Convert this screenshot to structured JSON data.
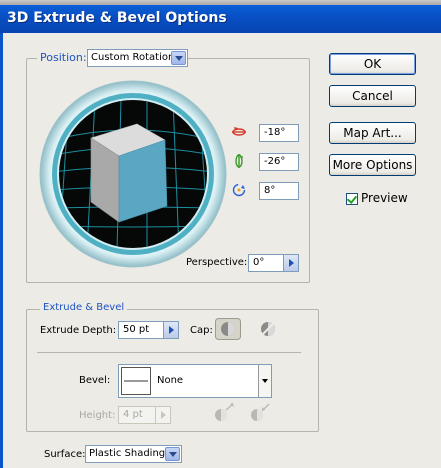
{
  "dialog": {
    "title": "3D Extrude & Bevel Options"
  },
  "position": {
    "label": "Position:",
    "selected": "Custom Rotation",
    "x_rotation": "-18°",
    "y_rotation": "-26°",
    "z_rotation": "8°",
    "perspective_label": "Perspective:",
    "perspective_value": "0°"
  },
  "buttons": {
    "ok": "OK",
    "cancel": "Cancel",
    "map_art": "Map Art...",
    "more_options": "More Options"
  },
  "preview": {
    "label": "Preview",
    "checked": true
  },
  "extrude": {
    "group_label": "Extrude & Bevel",
    "depth_label": "Extrude Depth:",
    "depth_value": "50 pt",
    "cap_label": "Cap:",
    "bevel_label": "Bevel:",
    "bevel_value": "None",
    "height_label": "Height:",
    "height_value": "4 pt"
  },
  "surface": {
    "label": "Surface:",
    "selected": "Plastic Shading"
  },
  "icons": [
    "x-rotation-icon",
    "y-rotation-icon",
    "z-rotation-icon",
    "cap-on-icon",
    "cap-off-icon",
    "bevel-out-icon",
    "bevel-in-icon"
  ]
}
